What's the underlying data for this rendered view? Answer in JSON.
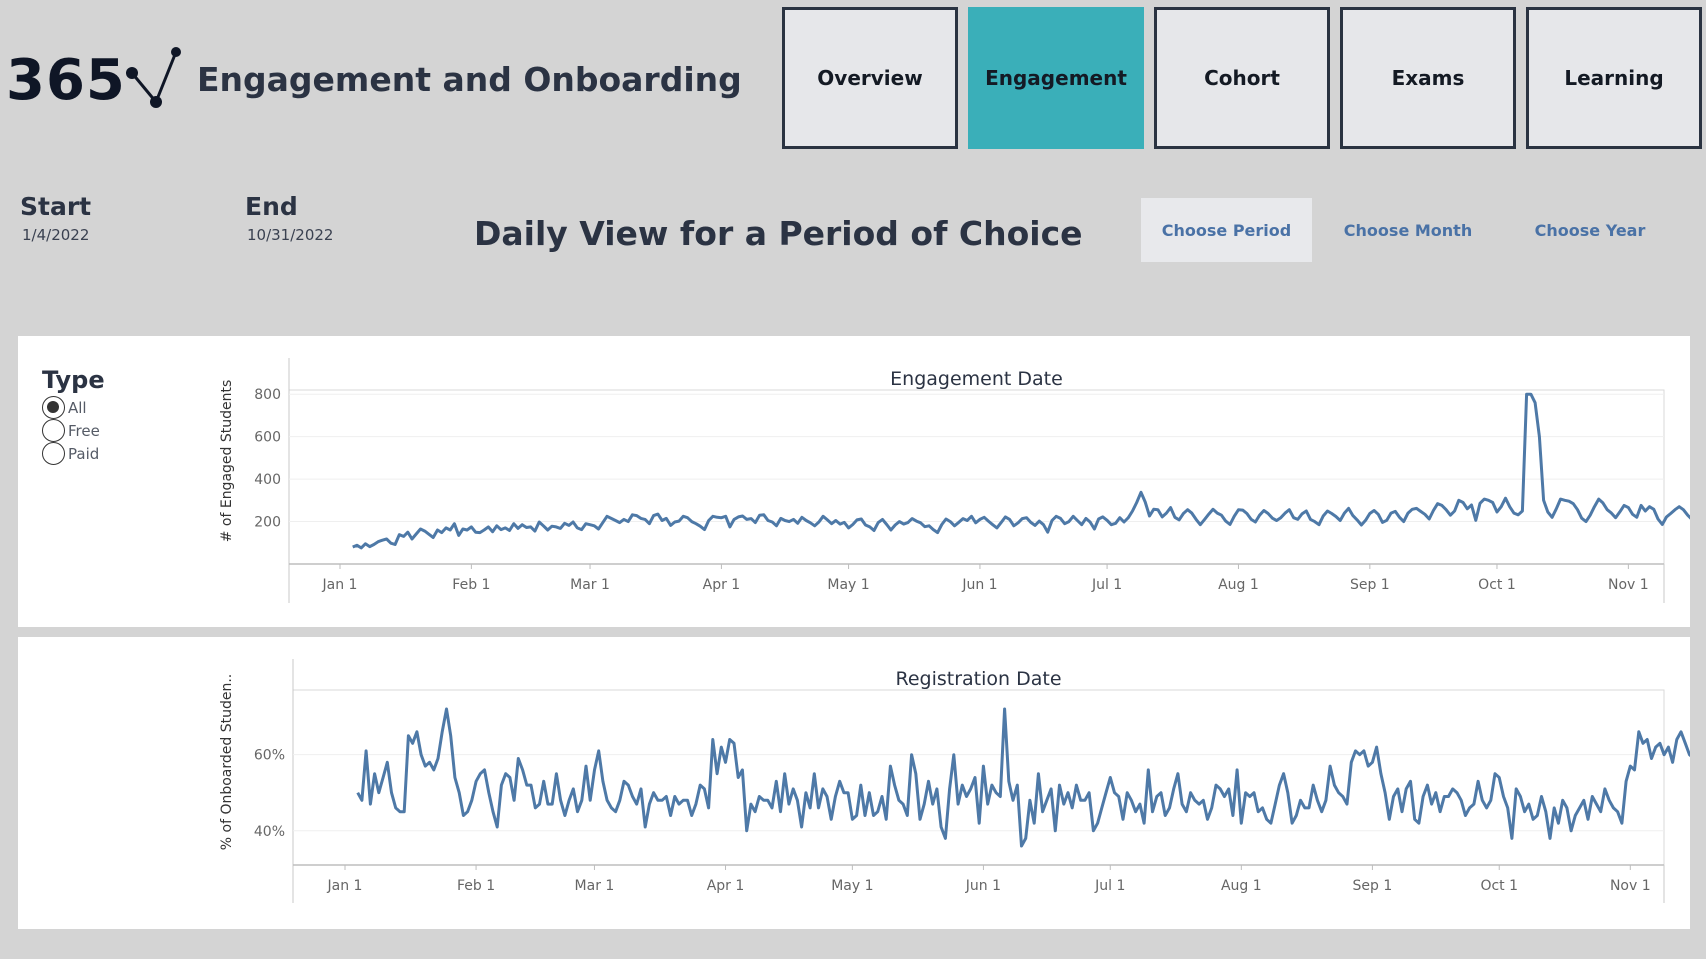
{
  "app": {
    "logo_text": "365",
    "title": "Engagement and Onboarding"
  },
  "nav": [
    {
      "label": "Overview",
      "active": false
    },
    {
      "label": "Engagement",
      "active": true
    },
    {
      "label": "Cohort",
      "active": false
    },
    {
      "label": "Exams",
      "active": false
    },
    {
      "label": "Learning",
      "active": false
    }
  ],
  "dates": {
    "start_label": "Start",
    "start_value": "1/4/2022",
    "end_label": "End",
    "end_value": "10/31/2022"
  },
  "view_title": "Daily View for a Period of Choice",
  "period_buttons": [
    {
      "label": "Choose Period",
      "active": true
    },
    {
      "label": "Choose Month",
      "active": false
    },
    {
      "label": "Choose Year",
      "active": false
    }
  ],
  "type_filter": {
    "title": "Type",
    "options": [
      "All",
      "Free",
      "Paid"
    ],
    "selected": "All"
  },
  "colors": {
    "accent": "#3aafb9",
    "line": "#4e79a7",
    "nav_border": "#2a3341"
  },
  "chart_data": [
    {
      "type": "line",
      "title": "Engagement Date",
      "ylabel": "# of Engaged Students",
      "xlabel": "",
      "x_ticks": [
        "Jan 1",
        "Feb 1",
        "Mar 1",
        "Apr 1",
        "May 1",
        "Jun 1",
        "Jul 1",
        "Aug 1",
        "Sep 1",
        "Oct 1",
        "Nov 1"
      ],
      "y_ticks": [
        200,
        400,
        600,
        800
      ],
      "ylim": [
        0,
        820
      ],
      "x_start": "2022-01-04",
      "y": [
        80,
        88,
        76,
        95,
        82,
        92,
        105,
        112,
        118,
        98,
        92,
        138,
        130,
        150,
        118,
        142,
        165,
        155,
        140,
        125,
        160,
        148,
        170,
        160,
        190,
        135,
        165,
        160,
        175,
        150,
        148,
        160,
        175,
        152,
        180,
        162,
        170,
        158,
        190,
        168,
        185,
        172,
        175,
        155,
        198,
        180,
        160,
        178,
        175,
        168,
        192,
        182,
        198,
        170,
        162,
        190,
        185,
        180,
        165,
        195,
        225,
        215,
        205,
        195,
        210,
        200,
        232,
        228,
        215,
        210,
        190,
        228,
        235,
        205,
        215,
        182,
        198,
        202,
        225,
        218,
        200,
        190,
        178,
        162,
        205,
        225,
        220,
        218,
        225,
        175,
        210,
        222,
        226,
        210,
        214,
        195,
        230,
        232,
        205,
        198,
        180,
        215,
        205,
        200,
        210,
        192,
        220,
        205,
        194,
        180,
        198,
        225,
        208,
        190,
        205,
        188,
        196,
        170,
        186,
        208,
        212,
        184,
        175,
        158,
        195,
        210,
        186,
        160,
        184,
        200,
        188,
        195,
        214,
        202,
        194,
        176,
        180,
        162,
        148,
        186,
        212,
        200,
        180,
        196,
        214,
        205,
        225,
        194,
        210,
        220,
        202,
        185,
        170,
        195,
        222,
        210,
        180,
        194,
        214,
        218,
        196,
        182,
        202,
        185,
        150,
        205,
        225,
        215,
        190,
        200,
        225,
        205,
        185,
        215,
        198,
        165,
        212,
        222,
        206,
        185,
        192,
        218,
        198,
        218,
        250,
        290,
        338,
        292,
        226,
        258,
        256,
        222,
        240,
        266,
        220,
        208,
        238,
        256,
        240,
        210,
        185,
        210,
        235,
        258,
        240,
        230,
        202,
        186,
        225,
        256,
        254,
        238,
        210,
        198,
        230,
        252,
        238,
        216,
        205,
        218,
        240,
        256,
        218,
        210,
        236,
        250,
        210,
        200,
        185,
        226,
        250,
        238,
        224,
        205,
        240,
        262,
        228,
        208,
        184,
        206,
        238,
        252,
        234,
        196,
        206,
        240,
        248,
        220,
        200,
        240,
        258,
        262,
        248,
        234,
        212,
        252,
        284,
        276,
        256,
        230,
        250,
        300,
        290,
        260,
        278,
        206,
        286,
        306,
        300,
        290,
        245,
        270,
        310,
        270,
        240,
        232,
        250,
        800,
        800,
        760,
        600,
        300,
        245,
        220,
        260,
        306,
        300,
        296,
        284,
        256,
        216,
        200,
        230,
        270,
        306,
        288,
        256,
        240,
        218,
        246,
        276,
        266,
        234,
        220,
        276,
        250,
        270,
        258,
        212,
        186,
        222,
        238,
        256,
        270,
        256,
        230,
        210,
        248,
        260,
        266,
        278,
        252,
        226,
        216,
        234,
        276,
        290,
        316,
        302,
        278,
        290,
        306,
        302,
        258,
        320,
        332,
        308,
        290,
        300,
        318,
        280,
        298,
        332,
        338,
        296,
        276,
        290,
        352,
        364,
        326,
        340,
        362,
        382,
        356,
        306,
        286,
        350,
        378,
        362,
        354,
        368,
        326,
        276,
        296,
        330,
        346,
        372,
        356,
        290,
        256,
        280,
        304,
        336,
        348,
        370,
        390,
        352,
        322,
        290,
        310,
        345,
        358,
        338
      ]
    },
    {
      "type": "line",
      "title": "Registration Date",
      "ylabel": "% of Onboarded Studen..",
      "xlabel": "",
      "x_ticks": [
        "Jan 1",
        "Feb 1",
        "Mar 1",
        "Apr 1",
        "May 1",
        "Jun 1",
        "Jul 1",
        "Aug 1",
        "Sep 1",
        "Oct 1",
        "Nov 1"
      ],
      "y_ticks": [
        "40%",
        "60%"
      ],
      "ylim": [
        31,
        77
      ],
      "x_start": "2022-01-04",
      "y": [
        50,
        48,
        61,
        47,
        55,
        50,
        54,
        58,
        50,
        46,
        45,
        45,
        65,
        63,
        66,
        60,
        57,
        58,
        56,
        59,
        66,
        72,
        65,
        54,
        50,
        44,
        45,
        48,
        53,
        55,
        56,
        50,
        45,
        41,
        52,
        55,
        54,
        48,
        59,
        56,
        52,
        52,
        46,
        47,
        53,
        47,
        47,
        55,
        48,
        44,
        48,
        51,
        45,
        48,
        57,
        48,
        56,
        61,
        53,
        48,
        46,
        45,
        48,
        53,
        52,
        49,
        47,
        51,
        41,
        47,
        50,
        48,
        48,
        49,
        44,
        49,
        47,
        48,
        48,
        44,
        47,
        52,
        51,
        46,
        64,
        55,
        62,
        58,
        64,
        63,
        54,
        56,
        40,
        47,
        45,
        49,
        48,
        48,
        46,
        53,
        45,
        55,
        47,
        51,
        48,
        41,
        50,
        46,
        55,
        46,
        51,
        49,
        43,
        49,
        53,
        50,
        50,
        43,
        44,
        52,
        44,
        50,
        44,
        45,
        49,
        43,
        57,
        52,
        48,
        47,
        44,
        60,
        55,
        43,
        47,
        53,
        47,
        51,
        41,
        38,
        51,
        60,
        47,
        52,
        49,
        51,
        54,
        42,
        57,
        47,
        52,
        50,
        49,
        72,
        53,
        48,
        52,
        36,
        38,
        48,
        42,
        55,
        45,
        48,
        51,
        40,
        52,
        47,
        50,
        46,
        52,
        48,
        48,
        50,
        40,
        42,
        46,
        50,
        54,
        50,
        49,
        43,
        50,
        48,
        45,
        47,
        42,
        56,
        45,
        49,
        50,
        44,
        46,
        51,
        55,
        47,
        45,
        50,
        48,
        47,
        48,
        43,
        46,
        52,
        51,
        49,
        51,
        44,
        56,
        42,
        50,
        49,
        50,
        45,
        46,
        43,
        42,
        47,
        52,
        55,
        50,
        42,
        44,
        48,
        46,
        46,
        52,
        48,
        45,
        48,
        57,
        52,
        50,
        49,
        47,
        58,
        61,
        60,
        61,
        57,
        58,
        62,
        55,
        50,
        43,
        49,
        51,
        45,
        51,
        53,
        43,
        42,
        49,
        52,
        47,
        50,
        45,
        49,
        49,
        51,
        50,
        48,
        44,
        46,
        47,
        53,
        48,
        46,
        48,
        55,
        54,
        49,
        46,
        38,
        51,
        49,
        45,
        47,
        43,
        44,
        49,
        45,
        38,
        46,
        42,
        48,
        46,
        40,
        44,
        46,
        48,
        43,
        49,
        47,
        45,
        51,
        48,
        46,
        45,
        42,
        53,
        57,
        56,
        66,
        63,
        64,
        59,
        62,
        63,
        60,
        62,
        58,
        64,
        66,
        63,
        60,
        59,
        63,
        62,
        63,
        64,
        62,
        67,
        65,
        62,
        60,
        61,
        61,
        62,
        64,
        65,
        63,
        60,
        64,
        63,
        58,
        59,
        62,
        63,
        59,
        52,
        55,
        60,
        66,
        59,
        62,
        64,
        56,
        63,
        56,
        52,
        59,
        57
      ]
    }
  ]
}
